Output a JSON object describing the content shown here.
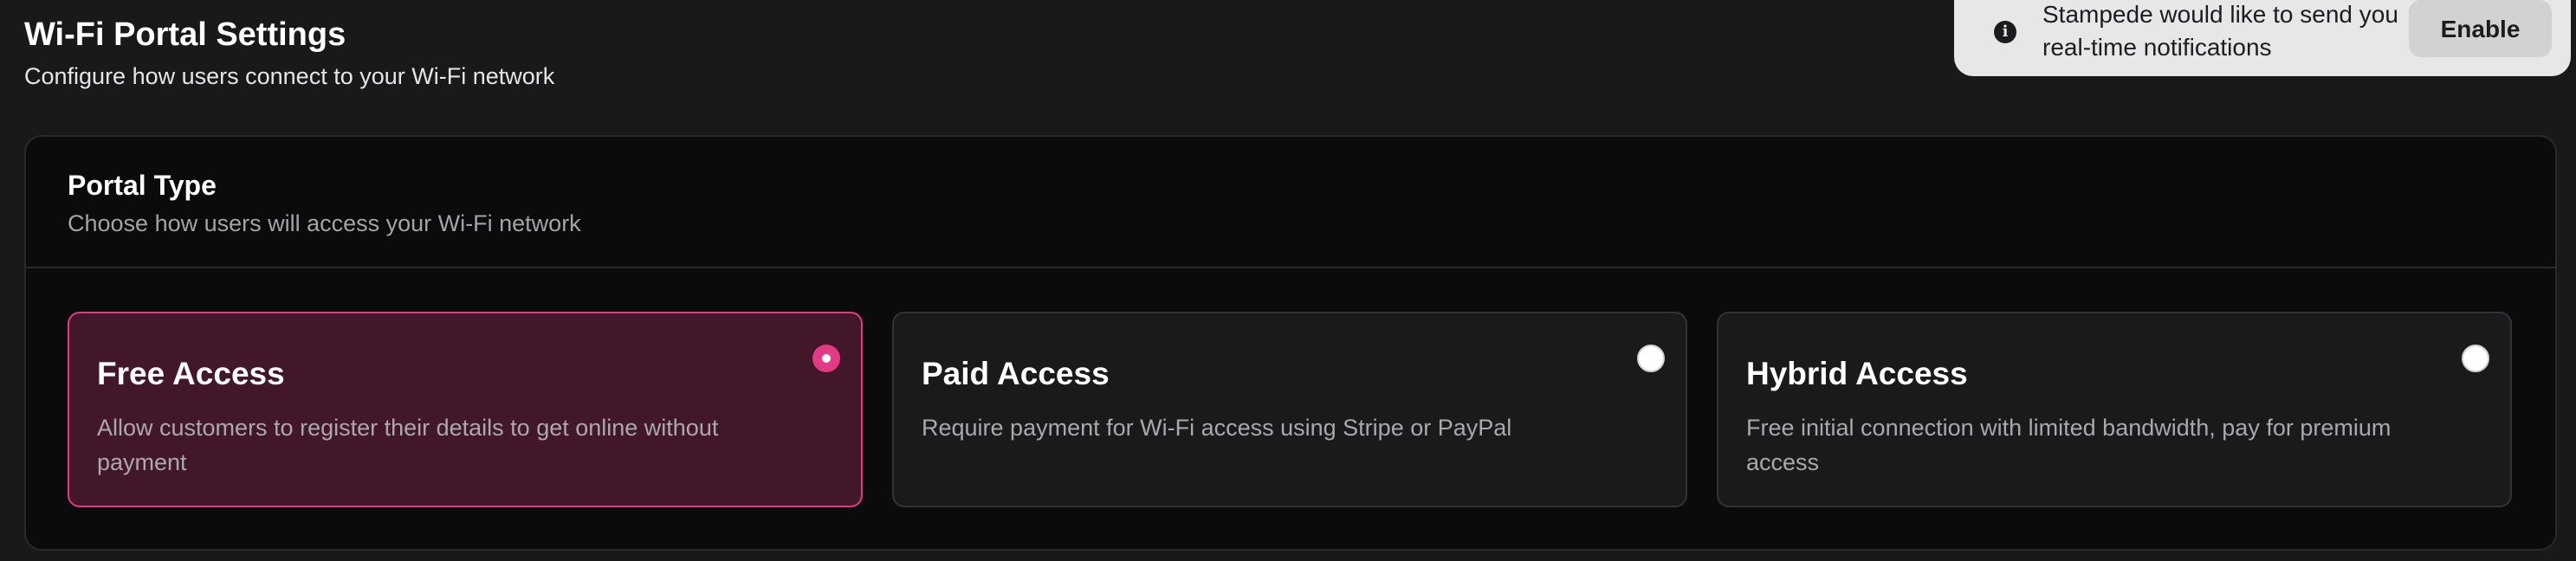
{
  "header": {
    "title": "Wi-Fi Portal Settings",
    "subtitle": "Configure how users connect to your Wi-Fi network"
  },
  "notification": {
    "icon": "info-icon",
    "message": "Stampede would like to send you real-time notifications",
    "button_label": "Enable"
  },
  "portal_type": {
    "title": "Portal Type",
    "subtitle": "Choose how users will access your Wi-Fi network",
    "accent_color": "#e23a84",
    "options": [
      {
        "title": "Free Access",
        "description": "Allow customers to register their details to get online without payment",
        "selected": true
      },
      {
        "title": "Paid Access",
        "description": "Require payment for Wi-Fi access using Stripe or PayPal",
        "selected": false
      },
      {
        "title": "Hybrid Access",
        "description": "Free initial connection with limited bandwidth, pay for premium access",
        "selected": false
      }
    ]
  }
}
